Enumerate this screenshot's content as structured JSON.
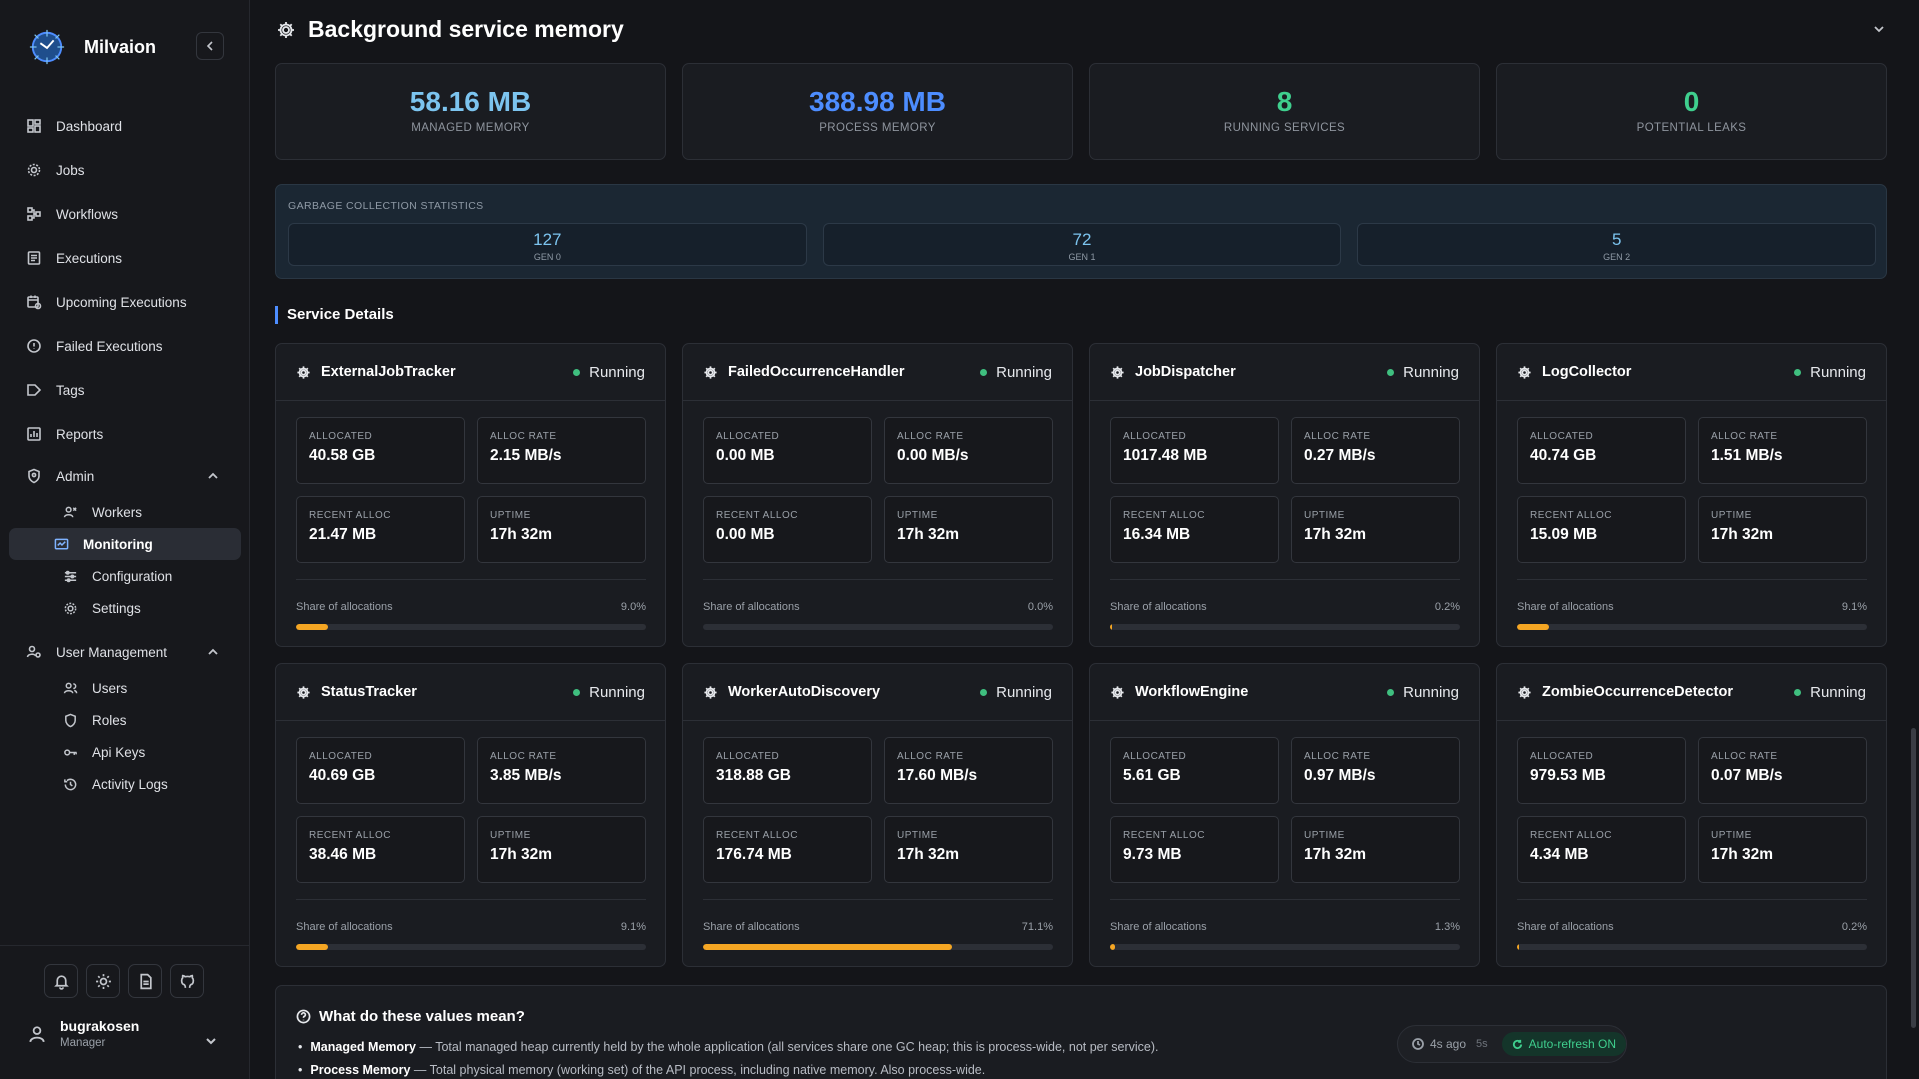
{
  "brand": {
    "name": "Milvaion"
  },
  "nav": {
    "items": [
      {
        "label": "Dashboard",
        "icon": "dashboard-icon"
      },
      {
        "label": "Jobs",
        "icon": "gear-icon"
      },
      {
        "label": "Workflows",
        "icon": "workflow-icon"
      },
      {
        "label": "Executions",
        "icon": "list-icon"
      },
      {
        "label": "Upcoming Executions",
        "icon": "calendar-icon"
      },
      {
        "label": "Failed Executions",
        "icon": "alert-icon"
      },
      {
        "label": "Tags",
        "icon": "tag-icon"
      },
      {
        "label": "Reports",
        "icon": "chart-icon"
      }
    ],
    "admin": {
      "label": "Admin",
      "items": [
        {
          "label": "Workers"
        },
        {
          "label": "Monitoring"
        },
        {
          "label": "Configuration"
        },
        {
          "label": "Settings"
        }
      ]
    },
    "user_management": {
      "label": "User Management",
      "items": [
        {
          "label": "Users"
        },
        {
          "label": "Roles"
        },
        {
          "label": "Api Keys"
        },
        {
          "label": "Activity Logs"
        }
      ]
    }
  },
  "user": {
    "name": "bugrakosen",
    "role": "Manager"
  },
  "page": {
    "title": "Background service memory"
  },
  "stats": [
    {
      "value": "58.16 MB",
      "label": "MANAGED MEMORY",
      "color": "#7cc4ef"
    },
    {
      "value": "388.98 MB",
      "label": "PROCESS MEMORY",
      "color": "#4d8dff"
    },
    {
      "value": "8",
      "label": "RUNNING SERVICES",
      "color": "#3fcf8e"
    },
    {
      "value": "0",
      "label": "POTENTIAL LEAKS",
      "color": "#3fcf8e"
    }
  ],
  "gc": {
    "title": "GARBAGE COLLECTION STATISTICS",
    "cells": [
      {
        "value": "127",
        "label": "GEN 0"
      },
      {
        "value": "72",
        "label": "GEN 1"
      },
      {
        "value": "5",
        "label": "GEN 2"
      }
    ]
  },
  "section": {
    "title": "Service Details"
  },
  "labels": {
    "allocated": "ALLOCATED",
    "alloc_rate": "ALLOC RATE",
    "recent_alloc": "RECENT ALLOC",
    "uptime": "UPTIME",
    "share": "Share of allocations"
  },
  "services": [
    {
      "name": "ExternalJobTracker",
      "status": "Running",
      "allocated": "40.58 GB",
      "alloc_rate": "2.15 MB/s",
      "recent_alloc": "21.47 MB",
      "uptime": "17h 32m",
      "share": "9.0%",
      "share_pct": 9.0
    },
    {
      "name": "FailedOccurrenceHandler",
      "status": "Running",
      "allocated": "0.00 MB",
      "alloc_rate": "0.00 MB/s",
      "recent_alloc": "0.00 MB",
      "uptime": "17h 32m",
      "share": "0.0%",
      "share_pct": 0.0
    },
    {
      "name": "JobDispatcher",
      "status": "Running",
      "allocated": "1017.48 MB",
      "alloc_rate": "0.27 MB/s",
      "recent_alloc": "16.34 MB",
      "uptime": "17h 32m",
      "share": "0.2%",
      "share_pct": 0.2
    },
    {
      "name": "LogCollector",
      "status": "Running",
      "allocated": "40.74 GB",
      "alloc_rate": "1.51 MB/s",
      "recent_alloc": "15.09 MB",
      "uptime": "17h 32m",
      "share": "9.1%",
      "share_pct": 9.1
    },
    {
      "name": "StatusTracker",
      "status": "Running",
      "allocated": "40.69 GB",
      "alloc_rate": "3.85 MB/s",
      "recent_alloc": "38.46 MB",
      "uptime": "17h 32m",
      "share": "9.1%",
      "share_pct": 9.1
    },
    {
      "name": "WorkerAutoDiscovery",
      "status": "Running",
      "allocated": "318.88 GB",
      "alloc_rate": "17.60 MB/s",
      "recent_alloc": "176.74 MB",
      "uptime": "17h 32m",
      "share": "71.1%",
      "share_pct": 71.1
    },
    {
      "name": "WorkflowEngine",
      "status": "Running",
      "allocated": "5.61 GB",
      "alloc_rate": "0.97 MB/s",
      "recent_alloc": "9.73 MB",
      "uptime": "17h 32m",
      "share": "1.3%",
      "share_pct": 1.3
    },
    {
      "name": "ZombieOccurrenceDetector",
      "status": "Running",
      "allocated": "979.53 MB",
      "alloc_rate": "0.07 MB/s",
      "recent_alloc": "4.34 MB",
      "uptime": "17h 32m",
      "share": "0.2%",
      "share_pct": 0.2
    }
  ],
  "help": {
    "title": "What do these values mean?",
    "items": [
      {
        "term": "Managed Memory",
        "text": " — Total managed heap currently held by the whole application (all services share one GC heap; this is process-wide, not per service)."
      },
      {
        "term": "Process Memory",
        "text": " — Total physical memory (working set) of the API process, including native memory. Also process-wide."
      }
    ]
  },
  "refresh": {
    "ago": "4s ago",
    "interval": "5s",
    "auto": "Auto-refresh ON"
  },
  "colors": {
    "accent": "#4d8dff",
    "running": "#3fbf7f",
    "bar": "#f5a623"
  }
}
